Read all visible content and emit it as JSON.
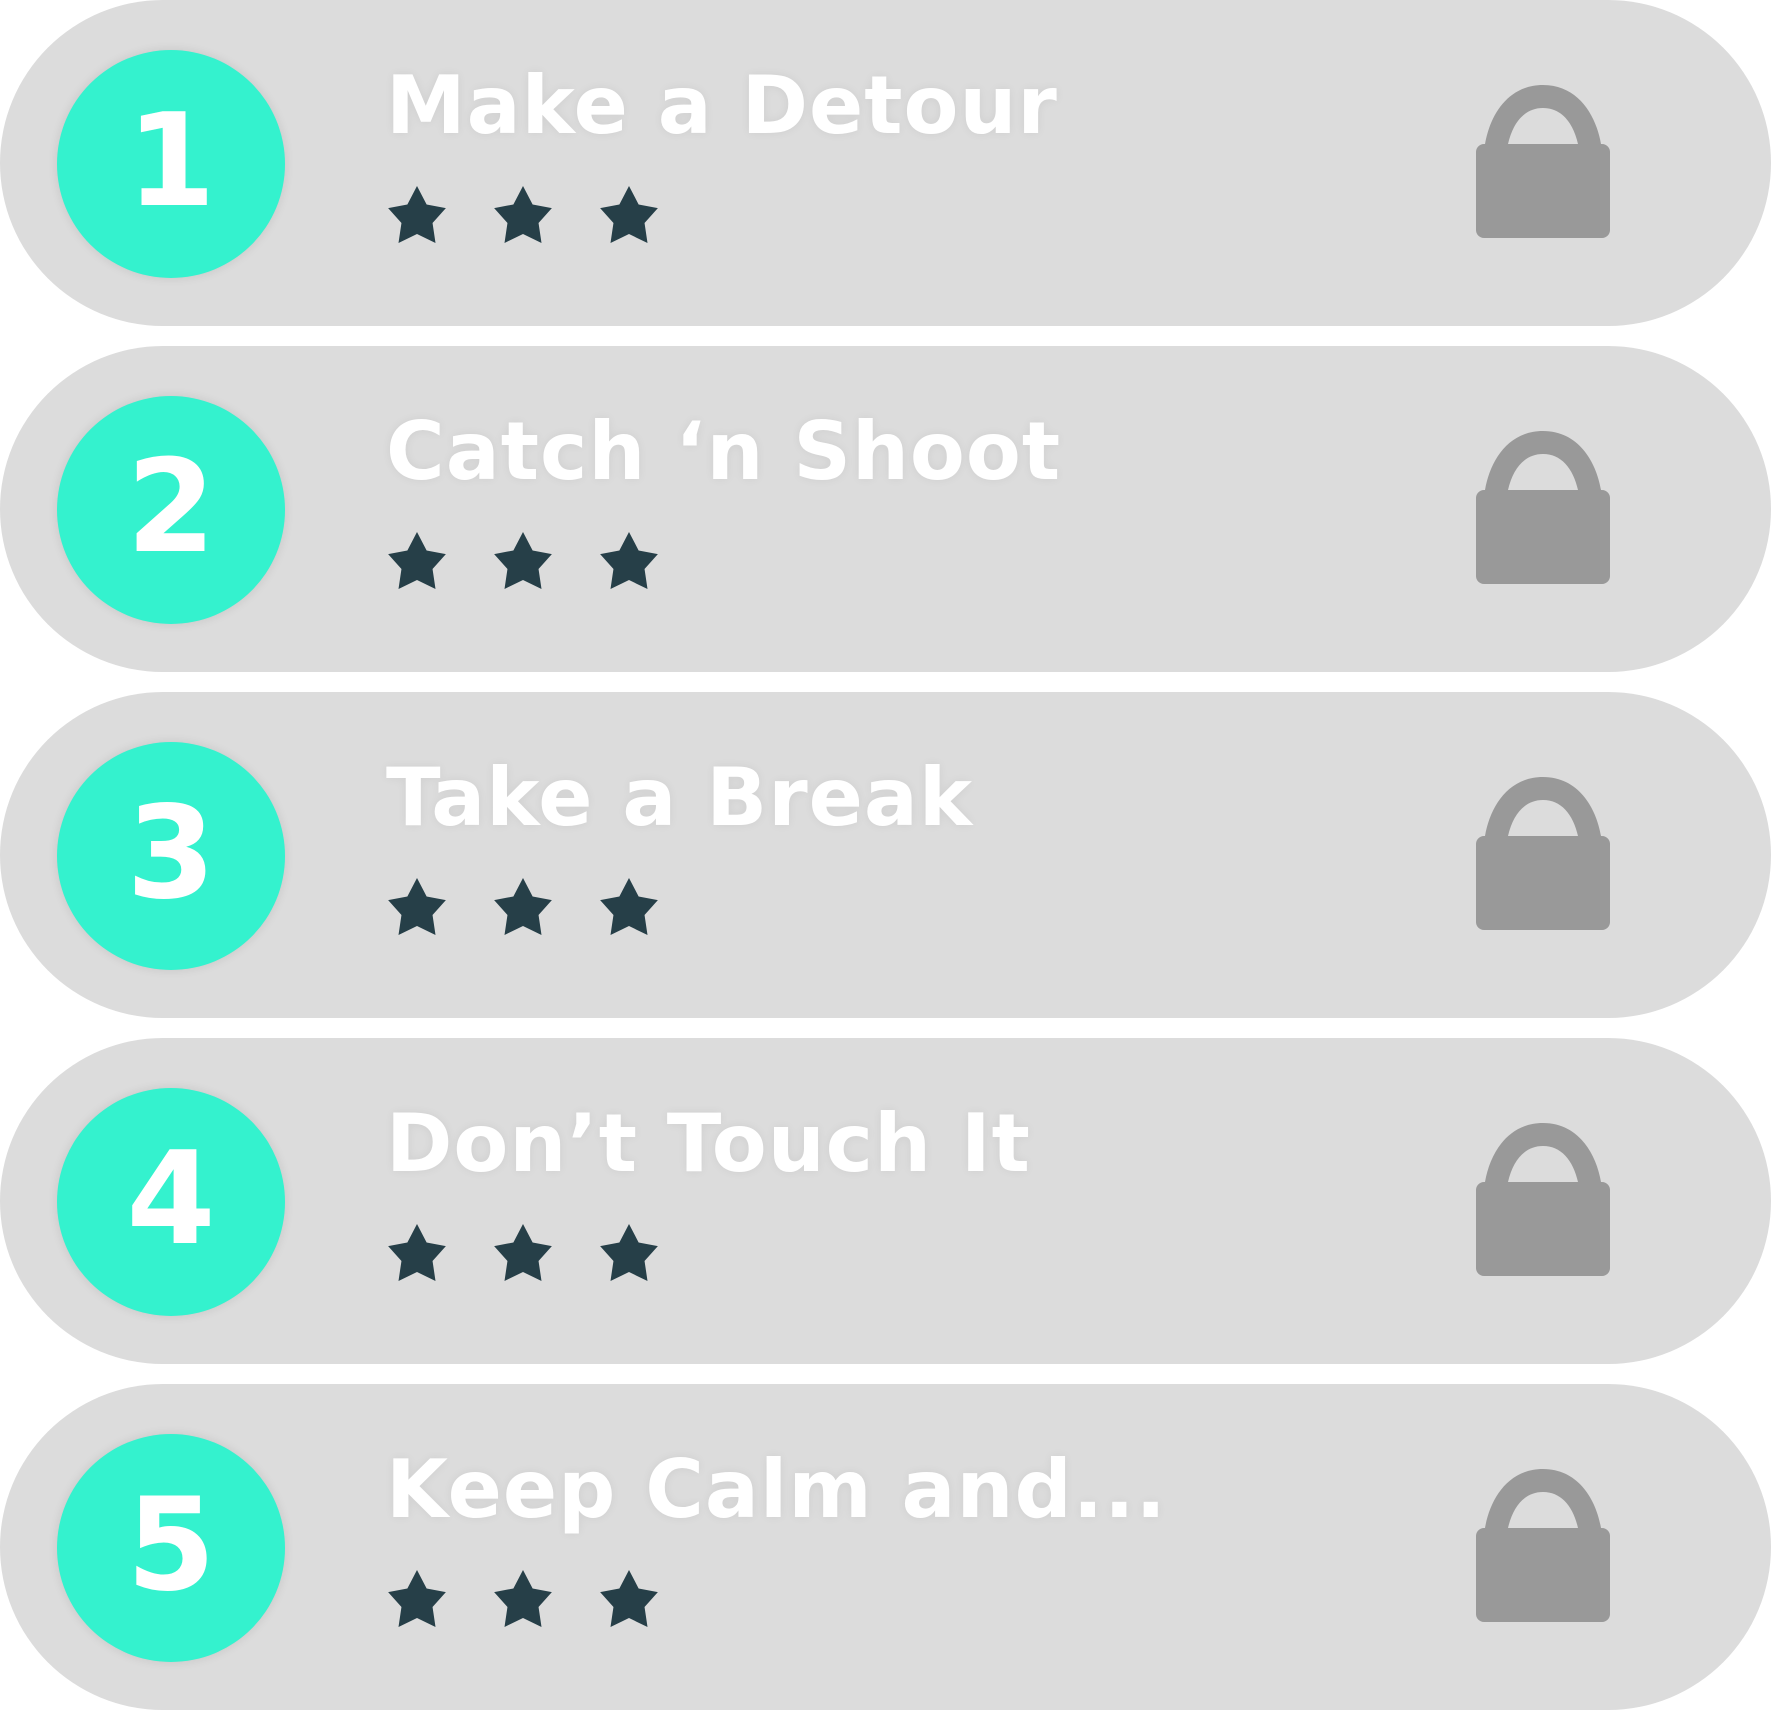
{
  "levels": [
    {
      "number": "1",
      "title": "Make a Detour",
      "stars_earned": 3,
      "stars_total": 3,
      "locked": true
    },
    {
      "number": "2",
      "title": "Catch ‘n Shoot",
      "stars_earned": 3,
      "stars_total": 3,
      "locked": true
    },
    {
      "number": "3",
      "title": "Take a Break",
      "stars_earned": 3,
      "stars_total": 3,
      "locked": true
    },
    {
      "number": "4",
      "title": "Don’t Touch It",
      "stars_earned": 3,
      "stars_total": 3,
      "locked": true
    },
    {
      "number": "5",
      "title": "Keep Calm and...",
      "stars_earned": 3,
      "stars_total": 3,
      "locked": true
    }
  ],
  "icons": {
    "star": "star-icon",
    "lock": "lock-icon"
  },
  "colors": {
    "row_background": "#dcdcdc",
    "badge": "#34f2ce",
    "star": "#263f48",
    "lock": "#999999",
    "text": "#ffffff"
  }
}
